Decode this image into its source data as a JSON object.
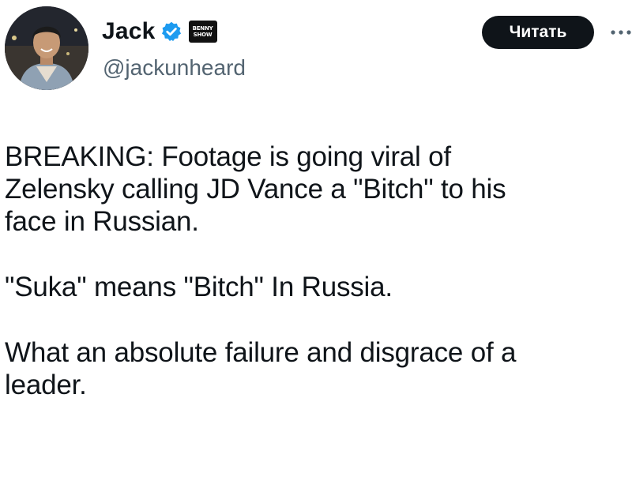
{
  "author": {
    "display_name": "Jack",
    "handle": "@jackunheard",
    "affiliate_badge": [
      "BENNY",
      "SHOW"
    ],
    "verified_color": "#1d9bf0"
  },
  "follow_button": {
    "label": "Читать"
  },
  "more_menu": {
    "icon": "more-horizontal-icon"
  },
  "tweet": {
    "paragraphs": [
      "BREAKING: Footage is going viral of\nZelensky calling JD Vance a \"Bitch\" to his\nface in Russian.",
      "\"Suka\" means \"Bitch\" In Russia.",
      "What an absolute failure and disgrace of a\nleader."
    ]
  }
}
